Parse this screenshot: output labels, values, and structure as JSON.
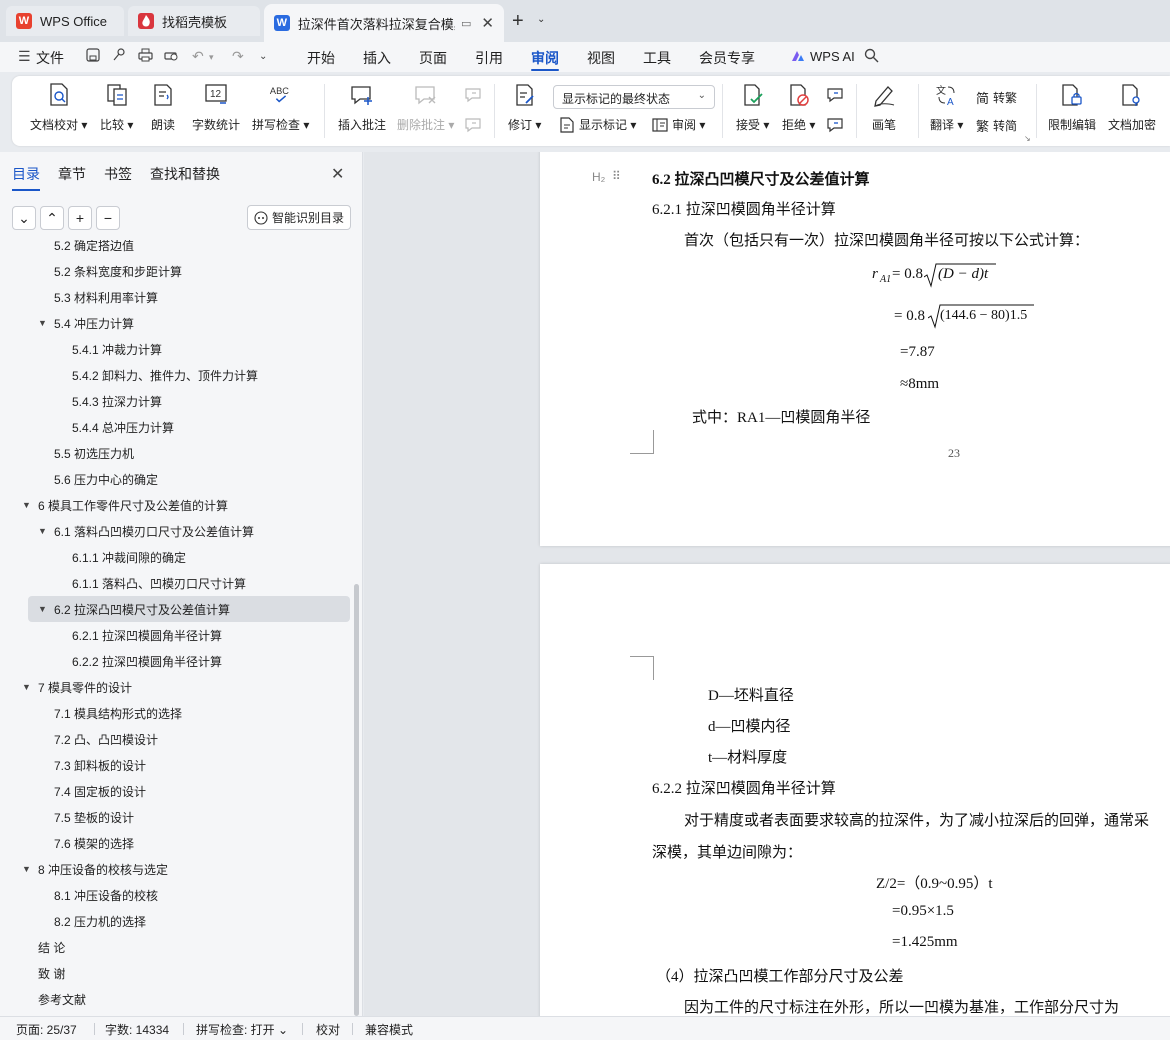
{
  "tabs": [
    {
      "label": "WPS Office"
    },
    {
      "label": "找稻壳模板"
    },
    {
      "label": "拉深件首次落料拉深复合模具设"
    }
  ],
  "menu": {
    "file": "文件",
    "items": [
      "开始",
      "插入",
      "页面",
      "引用",
      "审阅",
      "视图",
      "工具",
      "会员专享"
    ],
    "active": "审阅",
    "ai": "WPS AI"
  },
  "ribbon": {
    "proofread": "文档校对",
    "compare": "比较",
    "read_aloud": "朗读",
    "word_count": "字数统计",
    "spell_check": "拼写检查",
    "insert_comment": "插入批注",
    "delete_comment": "删除批注",
    "track_changes": "修订",
    "markup_state": "显示标记的最终状态",
    "show_markup": "显示标记",
    "review": "审阅",
    "accept": "接受",
    "reject": "拒绝",
    "pen": "画笔",
    "translate": "翻译",
    "to_traditional": "转繁",
    "to_simplified": "转简",
    "restrict_editing": "限制编辑",
    "encrypt": "文档加密",
    "word_count_icon_text": "12",
    "spell_icon_text": "ABC"
  },
  "panel": {
    "tabs": [
      "目录",
      "章节",
      "书签",
      "查找和替换"
    ],
    "smart_toc": "智能识别目录",
    "toc": [
      {
        "label": "5.2  确定搭边值",
        "level": 2,
        "arrow": ""
      },
      {
        "label": "5.2  条料宽度和步距计算",
        "level": 2,
        "arrow": ""
      },
      {
        "label": "5.3  材料利用率计算",
        "level": 2,
        "arrow": ""
      },
      {
        "label": "5.4  冲压力计算",
        "level": 2,
        "arrow": "▼"
      },
      {
        "label": "5.4.1 冲裁力计算",
        "level": 3,
        "arrow": ""
      },
      {
        "label": "5.4.2 卸料力、推件力、顶件力计算",
        "level": 3,
        "arrow": ""
      },
      {
        "label": "5.4.3 拉深力计算",
        "level": 3,
        "arrow": ""
      },
      {
        "label": "5.4.4 总冲压力计算",
        "level": 3,
        "arrow": ""
      },
      {
        "label": "5.5  初选压力机",
        "level": 2,
        "arrow": ""
      },
      {
        "label": "5.6 压力中心的确定",
        "level": 2,
        "arrow": ""
      },
      {
        "label": "6  模具工作零件尺寸及公差值的计算",
        "level": 1,
        "arrow": "▼"
      },
      {
        "label": "6.1 落料凸凹模刃口尺寸及公差值计算",
        "level": 2,
        "arrow": "▼"
      },
      {
        "label": "6.1.1 冲裁间隙的确定",
        "level": 3,
        "arrow": ""
      },
      {
        "label": "6.1.1 落料凸、凹模刃口尺寸计算",
        "level": 3,
        "arrow": ""
      },
      {
        "label": "6.2 拉深凸凹模尺寸及公差值计算",
        "level": 2,
        "arrow": "▼"
      },
      {
        "label": "6.2.1 拉深凹模圆角半径计算",
        "level": 3,
        "arrow": ""
      },
      {
        "label": "6.2.2 拉深凹模圆角半径计算",
        "level": 3,
        "arrow": ""
      },
      {
        "label": "7  模具零件的设计",
        "level": 1,
        "arrow": "▼"
      },
      {
        "label": "7.1  模具结构形式的选择",
        "level": 2,
        "arrow": ""
      },
      {
        "label": "7.2  凸、凸凹模设计",
        "level": 2,
        "arrow": ""
      },
      {
        "label": "7.3  卸料板的设计",
        "level": 2,
        "arrow": ""
      },
      {
        "label": "7.4  固定板的设计",
        "level": 2,
        "arrow": ""
      },
      {
        "label": "7.5  垫板的设计",
        "level": 2,
        "arrow": ""
      },
      {
        "label": "7.6  模架的选择",
        "level": 2,
        "arrow": ""
      },
      {
        "label": "8  冲压设备的校核与选定",
        "level": 1,
        "arrow": "▼"
      },
      {
        "label": "8.1  冲压设备的校核",
        "level": 2,
        "arrow": ""
      },
      {
        "label": "8.2 压力机的选择",
        "level": 2,
        "arrow": ""
      },
      {
        "label": "结    论",
        "level": 1,
        "arrow": ""
      },
      {
        "label": "致    谢",
        "level": 1,
        "arrow": ""
      },
      {
        "label": "参考文献",
        "level": 1,
        "arrow": ""
      }
    ],
    "selected_index": 14
  },
  "doc": {
    "heading_mark": "H₂",
    "h62": "6.2 拉深凸凹模尺寸及公差值计算",
    "h621": "6.2.1 拉深凹模圆角半径计算",
    "p1": "首次（包括只有一次）拉深凹模圆角半径可按以下公式计算：",
    "f1_lhs": "r",
    "f1_sub": "A1",
    "f1_eq": "= 0.8",
    "f1_rad": "(D − d)t",
    "f2_eq": "= 0.8",
    "f2_rad": "(144.6 − 80)1.5",
    "f3": "=7.87",
    "f4": "≈8mm",
    "p2": "式中：RA1—凹模圆角半径",
    "page_number": "23",
    "d_line": "D—坯料直径",
    "d2_line": "d—凹模内径",
    "t_line": "t—材料厚度",
    "h622": "6.2.2 拉深凹模圆角半径计算",
    "p3": "对于精度或者表面要求较高的拉深件，为了减小拉深后的回弹，通常采",
    "p3b": "深模，其单边间隙为：",
    "z1": "Z/2=（0.9~0.95）t",
    "z2": "=0.95×1.5",
    "z3": "=1.425mm",
    "h4": "（4）拉深凸凹模工作部分尺寸及公差",
    "p4": "因为工件的尺寸标注在外形，所以一凹模为基准，工作部分尺寸为"
  },
  "status": {
    "page": "页面: 25/37",
    "words": "字数: 14334",
    "spell": "拼写检查: 打开",
    "proof": "校对",
    "compat": "兼容模式"
  },
  "colors": {
    "accent": "#1a56c8",
    "wps_red": "#e8412f",
    "docer_red": "#d9363e",
    "writer_blue": "#2a6be0"
  }
}
